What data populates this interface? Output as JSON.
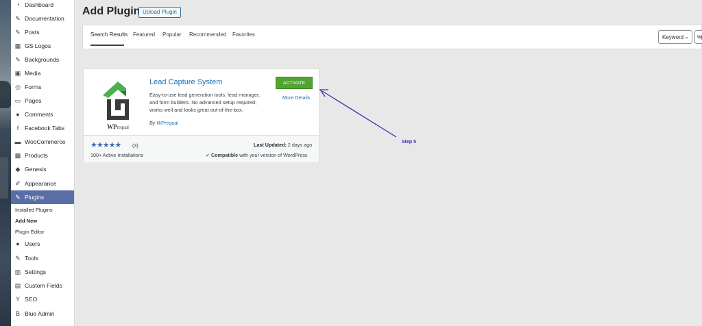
{
  "sidebar": {
    "items": [
      {
        "label": "Dashboard",
        "icon": "dashboard-icon",
        "glyph": "◔"
      },
      {
        "label": "Documentation",
        "icon": "pin-icon",
        "glyph": "✎"
      },
      {
        "label": "Posts",
        "icon": "pin-icon",
        "glyph": "✎"
      },
      {
        "label": "GS Logos",
        "icon": "grid-icon",
        "glyph": "▦"
      },
      {
        "label": "Backgrounds",
        "icon": "pin-icon",
        "glyph": "✎"
      },
      {
        "label": "Media",
        "icon": "media-icon",
        "glyph": "▣"
      },
      {
        "label": "Forms",
        "icon": "forms-icon",
        "glyph": "◎"
      },
      {
        "label": "Pages",
        "icon": "pages-icon",
        "glyph": "▭"
      },
      {
        "label": "Comments",
        "icon": "comments-icon",
        "glyph": "●"
      },
      {
        "label": "Facebook Tabs",
        "icon": "facebook-icon",
        "glyph": "f"
      },
      {
        "label": "WooCommerce",
        "icon": "woocommerce-icon",
        "glyph": "▬"
      },
      {
        "label": "Products",
        "icon": "products-icon",
        "glyph": "▩"
      },
      {
        "label": "Genesis",
        "icon": "genesis-icon",
        "glyph": "◆"
      },
      {
        "label": "Appearance",
        "icon": "brush-icon",
        "glyph": "✐"
      },
      {
        "label": "Plugins",
        "icon": "plugin-icon",
        "glyph": "✎"
      }
    ],
    "submenu": [
      "Installed Plugins",
      "Add New",
      "Plugin Editor"
    ],
    "items_after": [
      {
        "label": "Users",
        "icon": "users-icon",
        "glyph": "●"
      },
      {
        "label": "Tools",
        "icon": "tools-icon",
        "glyph": "✎"
      },
      {
        "label": "Settings",
        "icon": "settings-icon",
        "glyph": "▥"
      },
      {
        "label": "Custom Fields",
        "icon": "custom-fields-icon",
        "glyph": "▤"
      },
      {
        "label": "SEO",
        "icon": "seo-icon",
        "glyph": "Y"
      },
      {
        "label": "Blue Admin",
        "icon": "blue-admin-icon",
        "glyph": "B"
      }
    ]
  },
  "header": {
    "title": "Add Plugins",
    "upload_label": "Upload Plugin"
  },
  "filter": {
    "tabs": [
      "Search Results",
      "Featured",
      "Popular",
      "Recommended",
      "Favorites"
    ],
    "keyword_label": "Keyword",
    "search_value": "wp"
  },
  "plugin": {
    "name": "Lead Capture System",
    "description": "Easy-to-use lead generation tools, lead manager, and form builders. No advanced setup required; works well and looks great out-of-the-box.",
    "author_prefix": "By",
    "author": "WPrequal",
    "logo_text": "WPrequal",
    "activate_label": "ACTIVATE",
    "more_details": "More Details",
    "rating_count": "(3)",
    "rating_stars": 5,
    "installs": "100+ Active Installations",
    "last_updated_label": "Last Updated:",
    "last_updated_value": "2 days ago",
    "compat_bold": "Compatible",
    "compat_rest": "with your version of WordPress"
  },
  "annotation": {
    "step_label": "Step 5",
    "color": "#3a2fb0"
  },
  "colors": {
    "accent": "#2271b1",
    "active_menu": "#5a6ea6",
    "activate_button": "#52a431",
    "logo_green": "#4caf50",
    "logo_dark": "#3a3a3a"
  }
}
